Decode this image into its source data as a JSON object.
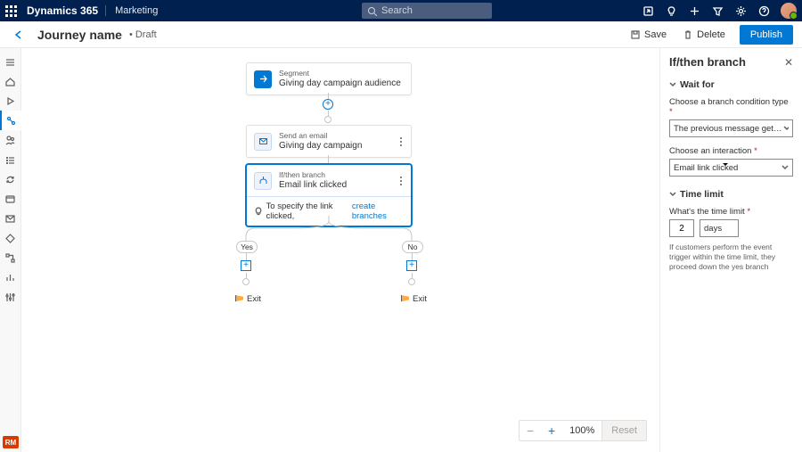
{
  "header": {
    "app": "Dynamics 365",
    "module": "Marketing",
    "search_placeholder": "Search"
  },
  "cmdbar": {
    "title": "Journey name",
    "status": "• Draft",
    "save": "Save",
    "delete": "Delete",
    "publish": "Publish"
  },
  "leftnav_badge": "RM",
  "nodes": {
    "segment": {
      "type": "Segment",
      "title": "Giving day campaign audience"
    },
    "email": {
      "type": "Send an email",
      "title": "Giving day campaign"
    },
    "branch": {
      "type": "If/then branch",
      "title": "Email link clicked"
    },
    "branch_hint_pre": "To specify the link clicked,",
    "branch_hint_link": "create branches",
    "yes": "Yes",
    "no": "No",
    "exit": "Exit"
  },
  "zoom": {
    "level": "100%",
    "reset": "Reset"
  },
  "pane": {
    "title": "If/then branch",
    "sec_waitfor": "Wait for",
    "label_condtype": "Choose a branch condition type",
    "val_condtype": "The previous message gets an interaction",
    "label_interaction": "Choose an interaction",
    "val_interaction": "Email link clicked",
    "sec_timelimit": "Time limit",
    "label_timelimit": "What's the time limit",
    "val_time": "2",
    "val_unit": "days",
    "help": "If customers perform the event trigger within the time limit, they proceed down the yes branch"
  }
}
